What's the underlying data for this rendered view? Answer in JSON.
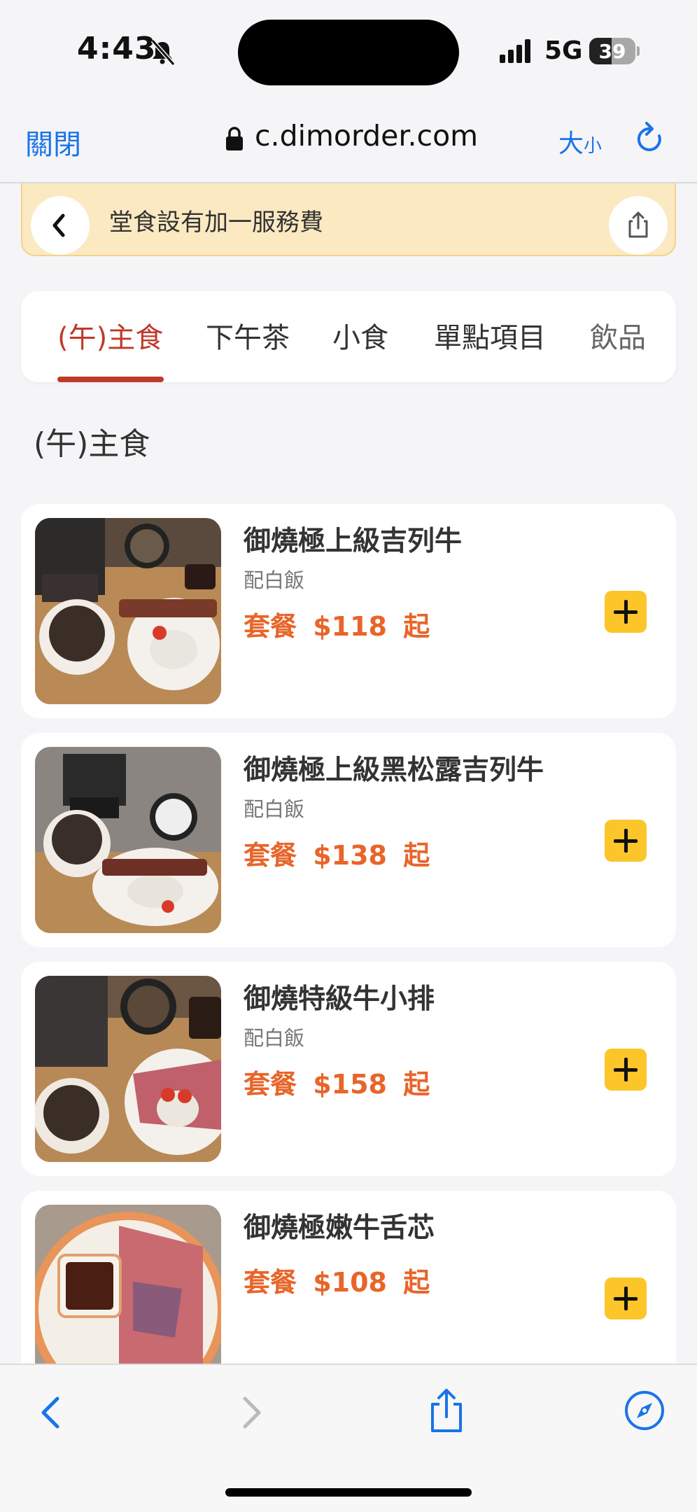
{
  "status": {
    "time": "4:43",
    "network": "5G",
    "battery": "39"
  },
  "browser": {
    "close_label": "關閉",
    "url": "c.dimorder.com",
    "text_size_big": "大",
    "text_size_small": "小"
  },
  "notice": {
    "text": "堂食設有加一服務費"
  },
  "tabs": [
    {
      "label": "(午)主食",
      "active": true
    },
    {
      "label": "下午茶"
    },
    {
      "label": "小食"
    },
    {
      "label": "單點項目"
    },
    {
      "label": "飲品"
    }
  ],
  "section_title": "(午)主食",
  "menu_items": [
    {
      "name": "御燒極上級吉列牛",
      "side": "配白飯",
      "price": "套餐 $118 起"
    },
    {
      "name": "御燒極上級黑松露吉列牛",
      "side": "配白飯",
      "price": "套餐 $138 起"
    },
    {
      "name": "御燒特級牛小排",
      "side": "配白飯",
      "price": "套餐 $158 起"
    },
    {
      "name": "御燒極嫩牛舌芯",
      "side": "",
      "price": "套餐 $108 起"
    }
  ],
  "colors": {
    "accent": "#c0392b",
    "price": "#e8652a",
    "add_button": "#fcc52a",
    "link": "#1a73e8",
    "notice_bg": "#fbe9c2"
  }
}
